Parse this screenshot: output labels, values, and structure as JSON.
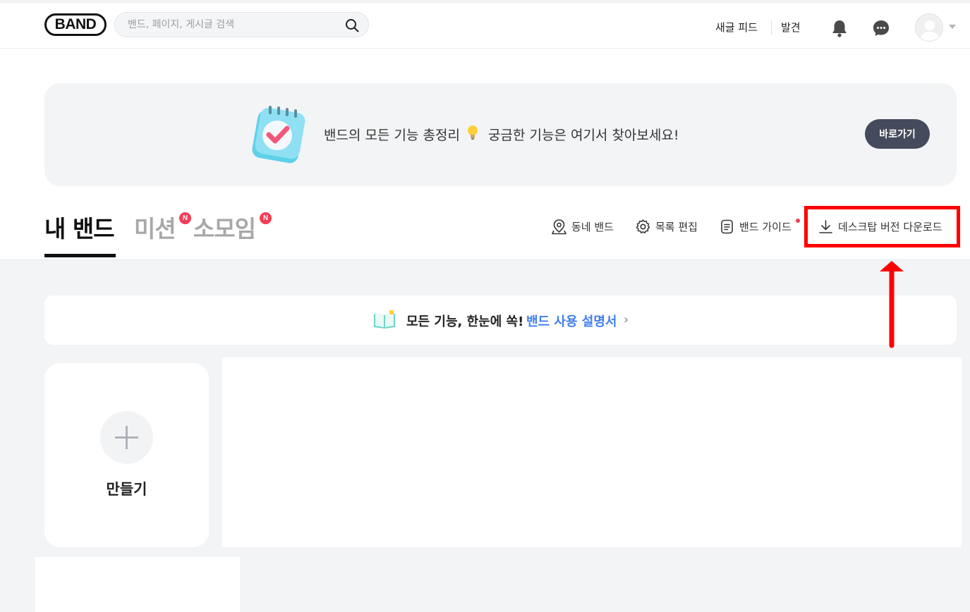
{
  "header": {
    "logo_text": "BAND",
    "search_placeholder": "밴드, 페이지, 게시글 검색",
    "nav_feed": "새글 피드",
    "nav_discover": "발견"
  },
  "banner": {
    "text_part1": "밴드의 모든 기능 총정리",
    "text_part2": "궁금한 기능은 여기서 찾아보세요!",
    "button_label": "바로가기"
  },
  "tabs": [
    {
      "label": "내 밴드",
      "active": true
    },
    {
      "label": "미션",
      "badge": "N"
    },
    {
      "label": "소모임",
      "badge": "N"
    }
  ],
  "tools": {
    "neighborhood": "동네 밴드",
    "list_edit": "목록 편집",
    "band_guide": "밴드 가이드",
    "desktop_download": "데스크탑 버전 다운로드"
  },
  "guide_bar": {
    "text": "모든 기능, 한눈에 쏙!",
    "link": "밴드 사용 설명서",
    "chevron": "›"
  },
  "create_card": {
    "label": "만들기"
  },
  "colors": {
    "accent_link": "#3f7ef0",
    "badge_red": "#f23d55",
    "button_dark": "#454a5c",
    "highlight": "#ff0000"
  }
}
